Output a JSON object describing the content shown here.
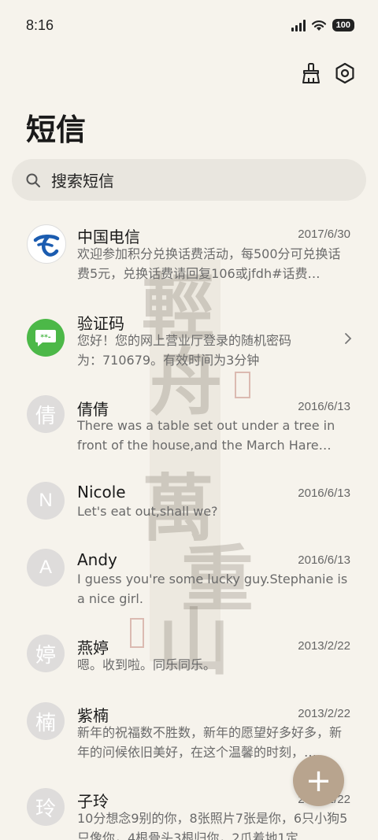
{
  "status_bar": {
    "time": "8:16",
    "battery": "100"
  },
  "toolbar": {
    "clean_icon": "broom-icon",
    "settings_icon": "settings-icon"
  },
  "header": {
    "title": "短信"
  },
  "search": {
    "placeholder": "搜索短信"
  },
  "messages": [
    {
      "name": "中国电信",
      "date": "2017/6/30",
      "preview": "欢迎参加积分兑换话费活动，每500分可兑换话费5元，兑换话费请回复106或jfdh#话费…",
      "avatar": "china-telecom-logo"
    },
    {
      "name": "验证码",
      "date": "",
      "preview": "您好！您的网上营业厅登录的随机密码为：710679。有效时间为3分钟",
      "avatar": "verification-code-icon"
    },
    {
      "name": "倩倩",
      "date": "2016/6/13",
      "preview": "There was a table set out under a tree in front of the house,and the March Hare an…",
      "avatar_text": "倩"
    },
    {
      "name": "Nicole",
      "date": "2016/6/13",
      "preview": "Let's eat out,shall we?",
      "avatar_text": "N"
    },
    {
      "name": "Andy",
      "date": "2016/6/13",
      "preview": "I guess you're some lucky guy.Stephanie is a nice girl.",
      "avatar_text": "A"
    },
    {
      "name": "燕婷",
      "date": "2013/2/22",
      "preview": "嗯。收到啦。同乐同乐。",
      "avatar_text": "婷"
    },
    {
      "name": "紫楠",
      "date": "2013/2/22",
      "preview": "新年的祝福数不胜数，新年的愿望好多好多，新年的问候依旧美好，在这个温馨的时刻，…",
      "avatar_text": "楠"
    },
    {
      "name": "子玲",
      "date": "2013/2/22",
      "preview": "10分想念9别的你，8张照片7张是你，6只小狗5只像你，4根骨头3根归你，2爪着地1定…",
      "avatar_text": "玲"
    }
  ],
  "fab": {
    "label": "+"
  },
  "colors": {
    "background": "#f6f3ec",
    "search_bg": "#e9e6df",
    "fab": "#b8a48e",
    "avatar": "#dedcdb",
    "green": "#4cb848",
    "telecom_blue": "#1b5cb0"
  }
}
